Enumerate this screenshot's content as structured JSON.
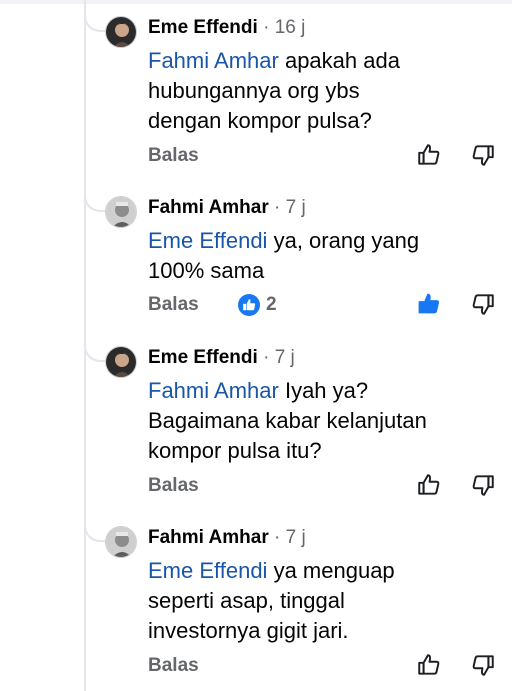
{
  "comments": [
    {
      "author": "Eme Effendi",
      "separator": " · ",
      "time": "16 j",
      "mention": "Fahmi Amhar",
      "text_lines": [
        "apakah ada",
        "hubungannya org ybs",
        "dengan kompor pulsa?"
      ],
      "reply_label": "Balas",
      "liked": false
    },
    {
      "author": "Fahmi Amhar",
      "separator": " · ",
      "time": "7 j",
      "mention": "Eme Effendi",
      "text_lines": [
        "ya, orang yang",
        "100% sama"
      ],
      "reply_label": "Balas",
      "reaction_count": "2",
      "liked": true
    },
    {
      "author": "Eme Effendi",
      "separator": " · ",
      "time": "7 j",
      "mention": "Fahmi Amhar",
      "text_lines": [
        "Iyah ya?",
        "Bagaimana kabar kelanjutan",
        "kompor pulsa itu?"
      ],
      "reply_label": "Balas",
      "liked": false
    },
    {
      "author": "Fahmi Amhar",
      "separator": " · ",
      "time": "7 j",
      "mention": "Eme Effendi",
      "text_lines": [
        "ya menguap",
        "seperti asap, tinggal",
        "investornya gigit jari."
      ],
      "reply_label": "Balas",
      "liked": false
    }
  ],
  "colors": {
    "mention": "#1a56a8",
    "like_active": "#1877f2",
    "muted": "#65676b"
  },
  "icons": {
    "like": "thumbs-up-icon",
    "dislike": "thumbs-down-icon",
    "reaction": "like-reaction-icon"
  }
}
